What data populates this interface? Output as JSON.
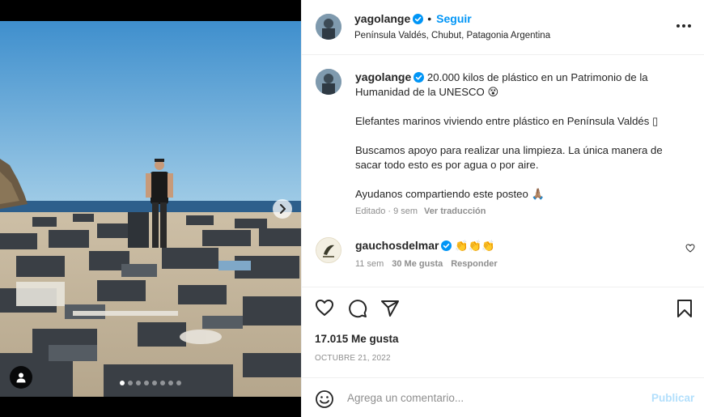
{
  "post": {
    "username": "yagolange",
    "follow_label": "Seguir",
    "separator": "•",
    "location": "Península Valdés, Chubut, Patagonia Argentina"
  },
  "caption": {
    "username": "yagolange",
    "paragraphs": [
      "20.000 kilos de plástico en un Patrimonio de la Humanidad de la UNESCO 😵",
      "Elefantes marinos viviendo entre plástico en Península Valdés ▯",
      "Buscamos apoyo para realizar una limpieza. La única manera de sacar todo esto es por agua o por aire.",
      "Ayudanos compartiendo este posteo 🙏🏽"
    ],
    "edited_time": "Editado · 9 sem",
    "translate_label": "Ver traducción"
  },
  "comment": {
    "username": "gauchosdelmar",
    "text": "👏👏👏",
    "time": "11 sem",
    "likes": "30 Me gusta",
    "reply_label": "Responder"
  },
  "stats": {
    "likes": "17.015 Me gusta",
    "date": "OCTUBRE 21, 2022"
  },
  "composer": {
    "placeholder": "Agrega un comentario...",
    "post_label": "Publicar"
  },
  "carousel": {
    "total_slides": 8,
    "active_slide": 1
  },
  "icons": {
    "verified": "verified-badge-icon",
    "more": "more-options-icon",
    "like": "heart-icon",
    "comment": "comment-icon",
    "share": "share-icon",
    "save": "bookmark-icon",
    "emoji": "emoji-icon",
    "next": "chevron-right-icon",
    "tags": "user-tag-icon"
  },
  "colors": {
    "accent": "#0095f6",
    "verified": "#0095f6",
    "post_disabled": "#b2dffc",
    "muted": "#8e8e8e"
  }
}
